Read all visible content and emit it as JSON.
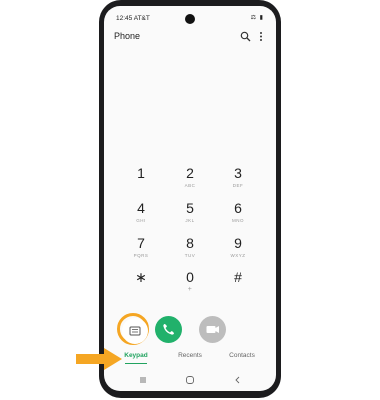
{
  "status_bar": {
    "time": "12:45 AT&T",
    "icons": "⚖ ▮"
  },
  "app": {
    "title": "Phone"
  },
  "header_icons": [
    "search-icon",
    "more-vertical-icon"
  ],
  "keypad": [
    {
      "digit": "1",
      "letters": ""
    },
    {
      "digit": "2",
      "letters": "ABC"
    },
    {
      "digit": "3",
      "letters": "DEF"
    },
    {
      "digit": "4",
      "letters": "GHI"
    },
    {
      "digit": "5",
      "letters": "JKL"
    },
    {
      "digit": "6",
      "letters": "MNO"
    },
    {
      "digit": "7",
      "letters": "PQRS"
    },
    {
      "digit": "8",
      "letters": "TUV"
    },
    {
      "digit": "9",
      "letters": "WXYZ"
    },
    {
      "digit": "∗",
      "letters": ""
    },
    {
      "digit": "0",
      "letters": "+"
    },
    {
      "digit": "#",
      "letters": ""
    }
  ],
  "actions": [
    "keypad-icon",
    "call-icon",
    "video-call-icon"
  ],
  "tabs": {
    "keypad": "Keypad",
    "recents": "Recents",
    "contacts": "Contacts",
    "active": "keypad"
  },
  "colors": {
    "accent": "#21a35f",
    "call": "#21b16b",
    "highlight": "#f5a623",
    "video": "#bdbdbd"
  },
  "nav_bar": [
    "recent-apps-icon",
    "home-icon",
    "back-icon"
  ]
}
